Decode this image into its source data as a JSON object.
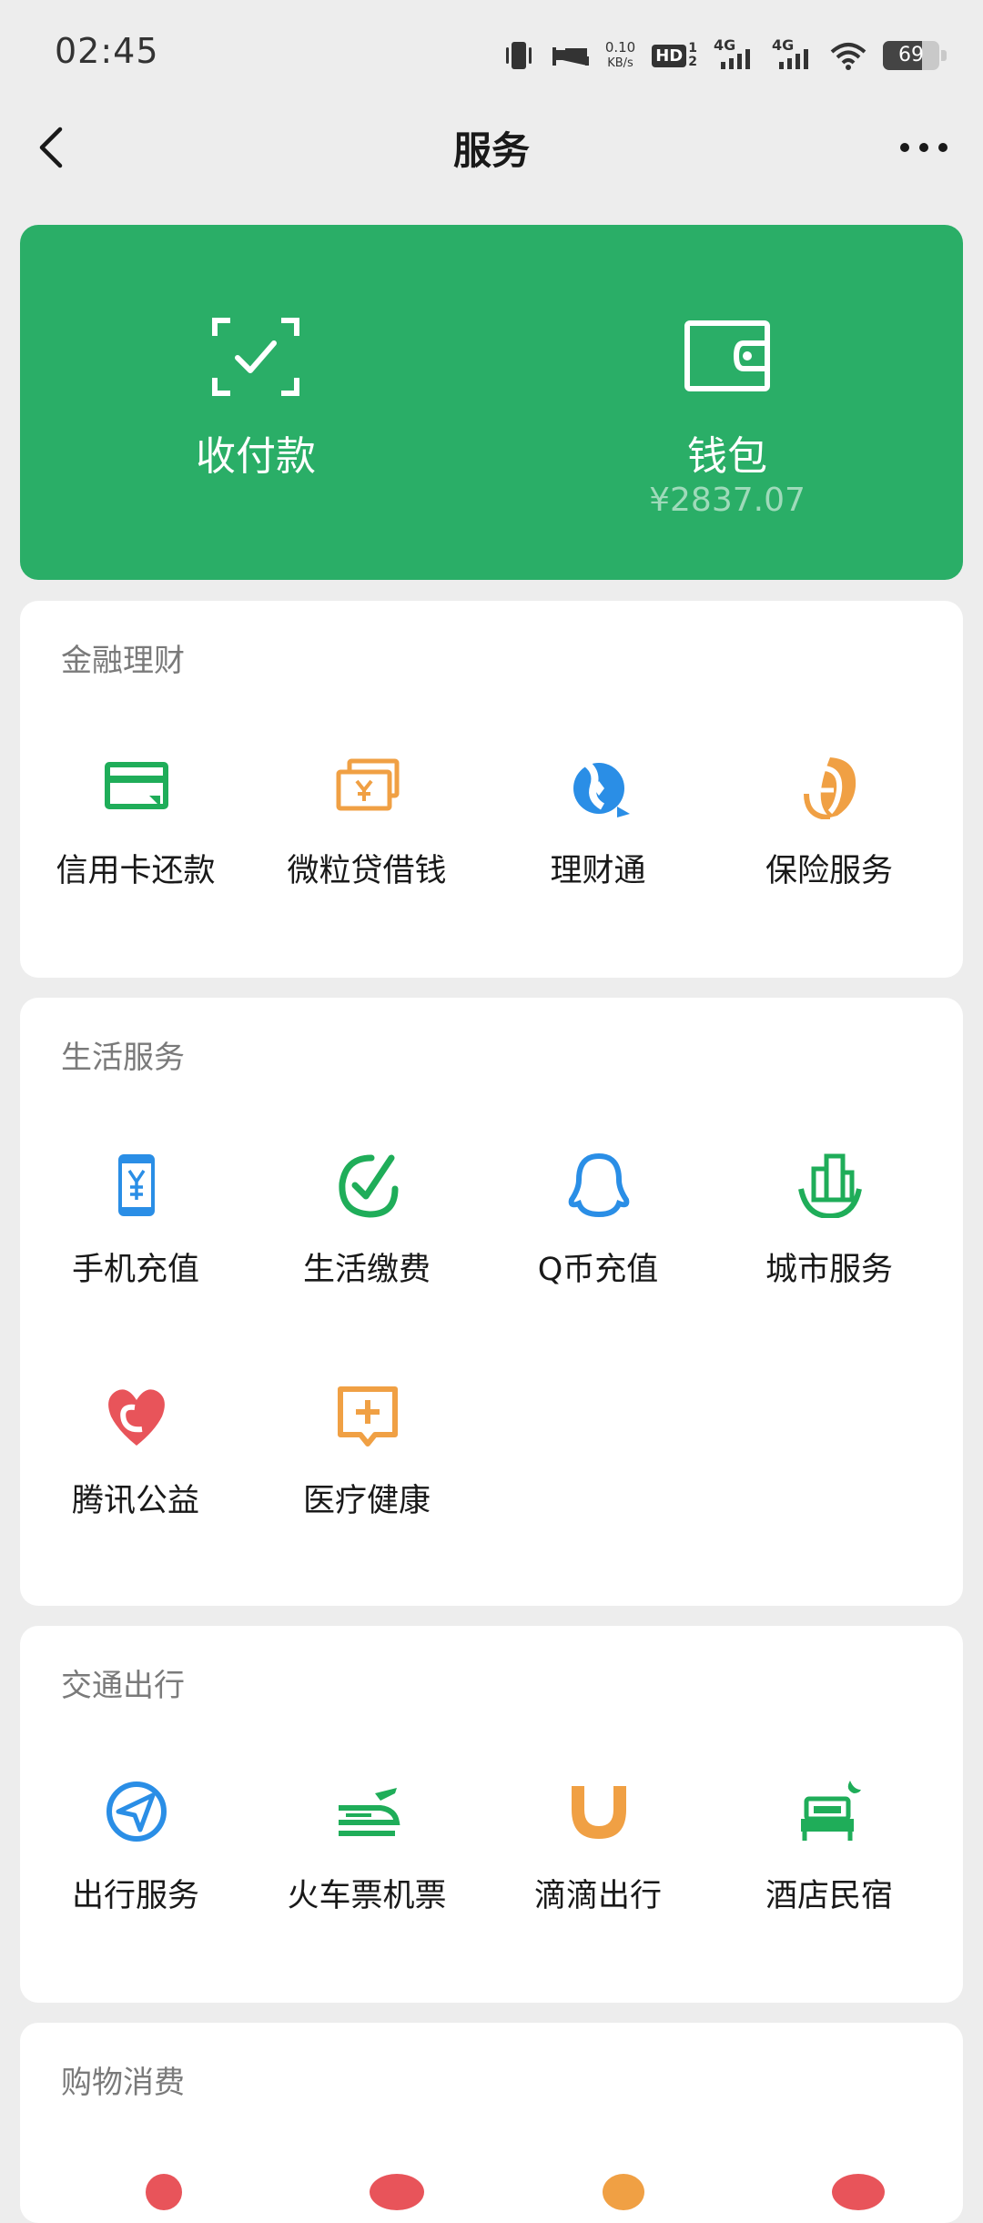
{
  "status_bar": {
    "time": "02:45",
    "net_speed_value": "0.10",
    "net_speed_unit": "KB/s",
    "hd_label": "HD",
    "sim1": "1",
    "sim2": "2",
    "sig1_label": "4G",
    "sig2_label": "4G",
    "battery_level": "69",
    "battery_fraction": 0.69
  },
  "nav": {
    "title": "服务"
  },
  "hero": {
    "pay_label": "收付款",
    "wallet_label": "钱包",
    "wallet_balance": "¥2837.07",
    "icon_names": [
      "scan-pay-icon",
      "wallet-icon"
    ]
  },
  "colors": {
    "brand_green": "#2aae67",
    "icon_green": "#1fad59",
    "icon_orange": "#f0a044",
    "icon_blue": "#2a8ee6",
    "icon_red": "#e8545a",
    "background": "#ededed"
  },
  "sections": [
    {
      "title": "金融理财",
      "items": [
        {
          "label": "信用卡还款",
          "icon": "credit-card-icon"
        },
        {
          "label": "微粒贷借钱",
          "icon": "loan-icon"
        },
        {
          "label": "理财通",
          "icon": "wealth-icon"
        },
        {
          "label": "保险服务",
          "icon": "insurance-icon"
        }
      ]
    },
    {
      "title": "生活服务",
      "items": [
        {
          "label": "手机充值",
          "icon": "phone-topup-icon"
        },
        {
          "label": "生活缴费",
          "icon": "utility-bill-icon"
        },
        {
          "label": "Q币充值",
          "icon": "qq-coin-icon"
        },
        {
          "label": "城市服务",
          "icon": "city-service-icon"
        },
        {
          "label": "腾讯公益",
          "icon": "charity-icon"
        },
        {
          "label": "医疗健康",
          "icon": "medical-icon"
        }
      ]
    },
    {
      "title": "交通出行",
      "items": [
        {
          "label": "出行服务",
          "icon": "travel-icon"
        },
        {
          "label": "火车票机票",
          "icon": "train-ticket-icon"
        },
        {
          "label": "滴滴出行",
          "icon": "didi-icon"
        },
        {
          "label": "酒店民宿",
          "icon": "hotel-icon"
        }
      ]
    },
    {
      "title": "购物消费"
    }
  ]
}
